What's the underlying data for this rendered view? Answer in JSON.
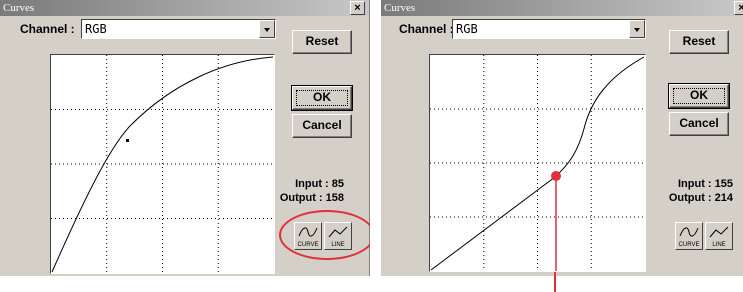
{
  "left_dialog": {
    "title": "Curves",
    "close_glyph": "×",
    "channel_label": "Channel :",
    "channel_value": "RGB",
    "reset_label": "Reset",
    "ok_label": "OK",
    "cancel_label": "Cancel",
    "input_text": "Input : 85",
    "output_text": "Output : 158",
    "curve_btn_label": "CURVE",
    "line_btn_label": "LINE",
    "curve_point": {
      "input": 85,
      "output": 158
    }
  },
  "right_dialog": {
    "title": "Curves",
    "close_glyph": "×",
    "channel_label": "Channel :",
    "channel_value": "RGB",
    "reset_label": "Reset",
    "ok_label": "OK",
    "cancel_label": "Cancel",
    "input_text": "Input : 155",
    "output_text": "Output : 214",
    "curve_btn_label": "CURVE",
    "line_btn_label": "LINE",
    "curve_point": {
      "input": 155,
      "output": 214
    }
  },
  "annotations": {
    "highlight_color": "#e0303a",
    "marker_color": "#e0303a"
  },
  "colors": {
    "dialog_bg": "#d4d0c8",
    "graph_bg": "#ffffff"
  }
}
